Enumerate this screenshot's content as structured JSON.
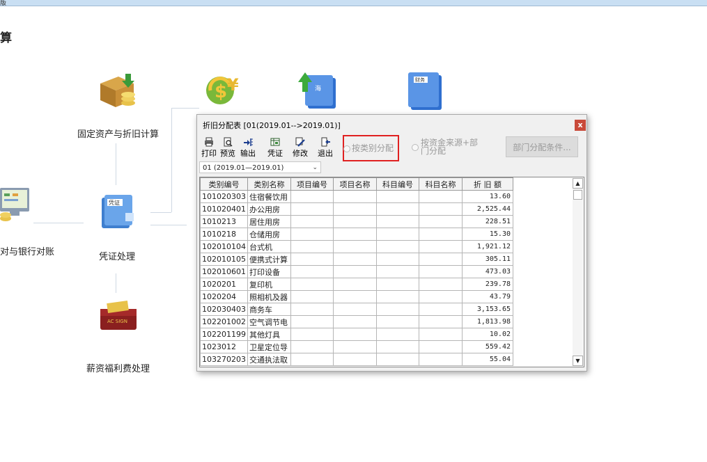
{
  "topbar": {
    "text": "版"
  },
  "section_title": "算",
  "flow": {
    "fixed_assets": "固定资产与折旧计算",
    "voucher": "凭证处理",
    "bank_reconcile": "对与银行对账",
    "salary": "薪资福利费处理"
  },
  "dialog": {
    "title": "折旧分配表 [01(2019.01-->2019.01)]",
    "close": "x",
    "toolbar": [
      {
        "label": "打印",
        "icon": "printer-icon"
      },
      {
        "label": "预览",
        "icon": "preview-icon"
      },
      {
        "label": "输出",
        "icon": "export-icon"
      },
      {
        "label": "凭证",
        "icon": "voucher-icon"
      },
      {
        "label": "修改",
        "icon": "edit-icon"
      },
      {
        "label": "退出",
        "icon": "exit-icon"
      }
    ],
    "period": "01 (2019.01—2019.01)",
    "option_category": "按类别分配",
    "option_source_line1": "按资金来源+部",
    "option_source_line2": "门分配",
    "dept_button": "部门分配条件...",
    "columns": [
      "类别编号",
      "类别名称",
      "项目编号",
      "项目名称",
      "科目编号",
      "科目名称",
      "折  旧  额"
    ],
    "rows": [
      {
        "code": "101020303",
        "name": "住宿餐饮用",
        "amount": "13.60"
      },
      {
        "code": "101020401",
        "name": "办公用房",
        "amount": "2,525.44"
      },
      {
        "code": "1010213",
        "name": "居住用房",
        "amount": "228.51"
      },
      {
        "code": "1010218",
        "name": "仓储用房",
        "amount": "15.30"
      },
      {
        "code": "102010104",
        "name": "台式机",
        "amount": "1,921.12"
      },
      {
        "code": "102010105",
        "name": "便携式计算",
        "amount": "305.11"
      },
      {
        "code": "102010601",
        "name": "打印设备",
        "amount": "473.03"
      },
      {
        "code": "1020201",
        "name": "复印机",
        "amount": "239.78"
      },
      {
        "code": "1020204",
        "name": "照相机及器",
        "amount": "43.79"
      },
      {
        "code": "102030403",
        "name": "商务车",
        "amount": "3,153.65"
      },
      {
        "code": "102201002",
        "name": "空气调节电",
        "amount": "1,813.98"
      },
      {
        "code": "102201199",
        "name": "其他灯具",
        "amount": "10.02"
      },
      {
        "code": "1023012",
        "name": "卫星定位导",
        "amount": "559.42"
      },
      {
        "code": "103270203",
        "name": "交通执法取",
        "amount": "55.04"
      }
    ]
  },
  "colors": {
    "accent_red": "#e02020",
    "close_bg": "#c94a3a"
  }
}
